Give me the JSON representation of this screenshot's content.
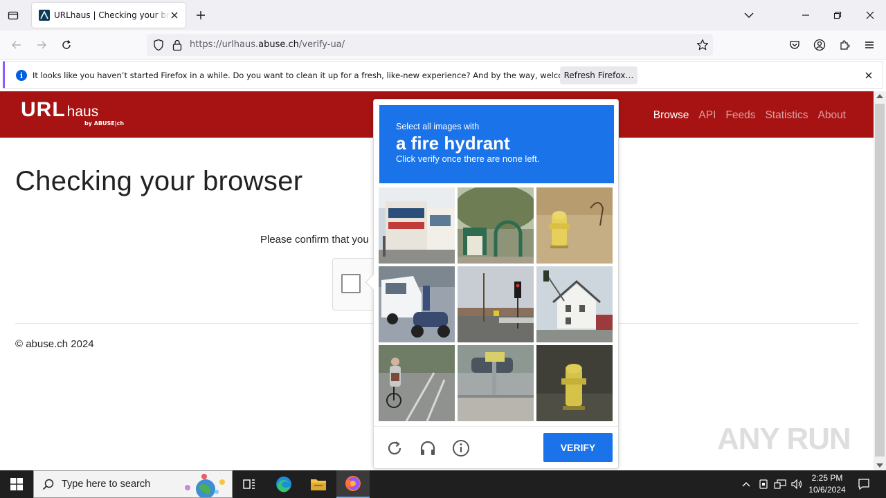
{
  "browser": {
    "tab_title": "URLhaus | Checking your browser",
    "url_prefix": "https://urlhaus.",
    "url_host": "abuse.ch",
    "url_path": "/verify-ua/"
  },
  "notification": {
    "message": "It looks like you haven’t started Firefox in a while. Do you want to clean it up for a fresh, like-new experience? And by the way, welcome back!",
    "button": "Refresh Firefox…"
  },
  "site": {
    "logo_url": "URL",
    "logo_haus": "haus",
    "logo_by": "by ABUSE|ch",
    "nav": [
      "Browse",
      "API",
      "Feeds",
      "Statistics",
      "About"
    ],
    "title": "Checking your browser",
    "confirm": "Please confirm that you",
    "copyright": "© abuse.ch 2024"
  },
  "captcha": {
    "prompt": "Select all images with",
    "target": "a fire hydrant",
    "subprompt": "Click verify once there are none left.",
    "verify_label": "VERIFY",
    "images": [
      "street-storefront",
      "park-gate",
      "yellow-hydrant-dry-grass",
      "van-and-scooter",
      "traffic-light-intersection",
      "traffic-light-house",
      "cyclist",
      "street-sign-pole",
      "yellow-hydrant-dark"
    ]
  },
  "watermark": "ANY RUN",
  "taskbar": {
    "search_placeholder": "Type here to search",
    "time": "2:25 PM",
    "date": "10/6/2024"
  },
  "colors": {
    "site_header": "#a61312",
    "captcha_blue": "#1a73e8"
  }
}
